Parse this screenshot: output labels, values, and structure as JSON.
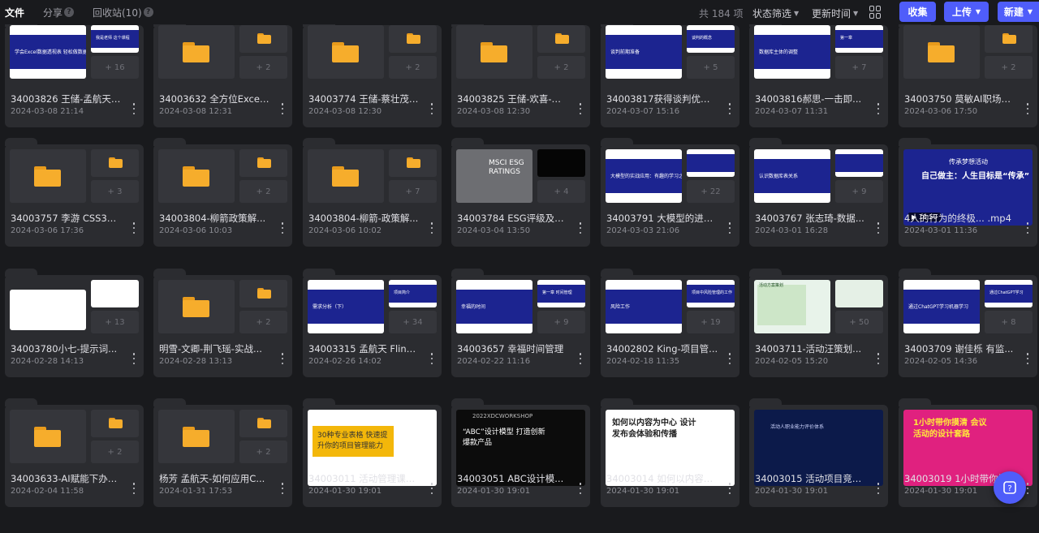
{
  "tabs": [
    {
      "label": "文件",
      "active": true
    },
    {
      "label": "分享",
      "active": false
    },
    {
      "label": "回收站(10)",
      "active": false
    }
  ],
  "toolbar": {
    "count": "共 184 项",
    "status_filter": "状态筛选",
    "update_time": "更新时间",
    "view_icon": "grid-view-icon",
    "collect_label": "收集",
    "upload_label": "上传",
    "new_label": "新建"
  },
  "colors": {
    "accent": "#4f5dfa",
    "folder": "#f6ad2c",
    "slide_navy": "#1c2490"
  },
  "cards": [
    {
      "name": "34003826 王储-孟航天 ...",
      "date": "2024-03-08 21:14",
      "count": "+ 16",
      "kind": "slides-navy",
      "big_text": "学会Excel数据透视表 轻松做数据统计",
      "sm_text": "我是老师 这个课程"
    },
    {
      "name": "34003632 全方位Excel...",
      "date": "2024-03-08 12:31",
      "count": "+ 2",
      "kind": "folder"
    },
    {
      "name": "34003774 王储-蔡壮茂-...",
      "date": "2024-03-08 12:30",
      "count": "+ 2",
      "kind": "folder"
    },
    {
      "name": "34003825 王储-欢喜-内...",
      "date": "2024-03-08 12:30",
      "count": "+ 2",
      "kind": "folder"
    },
    {
      "name": "34003817获得谈判优势...",
      "date": "2024-03-07 15:16",
      "count": "+ 5",
      "kind": "slides-navy",
      "big_text": "谈判前期准备",
      "sm_text": "谈判的概念"
    },
    {
      "name": "34003816郝思-一击即...",
      "date": "2024-03-07 11:31",
      "count": "+ 7",
      "kind": "slides-navy",
      "big_text": "数据库主体的调整",
      "sm_text": "第一章"
    },
    {
      "name": "34003750 莫敏AI职场发...",
      "date": "2024-03-06 17:50",
      "count": "+ 2",
      "kind": "folder"
    },
    {
      "name": "34003757 李游 CSS3课...",
      "date": "2024-03-06 17:36",
      "count": "+ 3",
      "kind": "folder"
    },
    {
      "name": "34003804-柳箭政策解...",
      "date": "2024-03-06 10:03",
      "count": "+ 2",
      "kind": "folder"
    },
    {
      "name": "34003804-柳箭-政策解...",
      "date": "2024-03-06 10:02",
      "count": "+ 7",
      "kind": "folder"
    },
    {
      "name": "34003784 ESG评级及方...",
      "date": "2024-03-04 13:50",
      "count": "+ 4",
      "kind": "esg",
      "big_text": "MSCI ESG RATINGS",
      "sm_text": ""
    },
    {
      "name": "34003791 大模型的进阶...",
      "date": "2024-03-03 21:06",
      "count": "+ 22",
      "kind": "slides-navy",
      "big_text": "大模型的实战应用：有趣的学习之机器学习",
      "sm_text": ""
    },
    {
      "name": "34003767 张志琦-数据...",
      "date": "2024-03-01 16:28",
      "count": "+ 9",
      "kind": "slides-navy",
      "big_text": "认识数据库表关系",
      "sm_text": ""
    },
    {
      "name": "4人的行为的终极...   .mp4",
      "date": "2024-03-01 11:36",
      "count": "",
      "kind": "video",
      "big_text": "传承梦想活动",
      "sm_text": "自己做主：人生目标是“传承”",
      "duration": "10:50"
    },
    {
      "name": "34003780小七-提示词...",
      "date": "2024-02-28 14:13",
      "count": "+ 13",
      "kind": "white",
      "big_text": "",
      "sm_text": ""
    },
    {
      "name": "明雪-文卿-荆飞瑶-实战...",
      "date": "2024-02-28 13:13",
      "count": "+ 2",
      "kind": "folder"
    },
    {
      "name": "34003315 孟航天 Flink...",
      "date": "2024-02-26 14:02",
      "count": "+ 34",
      "kind": "slides-navy",
      "big_text": "需求分析（下）",
      "sm_text": "项目简介"
    },
    {
      "name": "34003657 幸福时间管理",
      "date": "2024-02-22 11:16",
      "count": "+ 9",
      "kind": "slides-navy",
      "big_text": "幸福的时间",
      "sm_text": "第一章 时间管理"
    },
    {
      "name": "34002802 King-项目管...",
      "date": "2024-02-18 11:35",
      "count": "+ 19",
      "kind": "slides-navy",
      "big_text": "风险工作",
      "sm_text": "项目中风险管理的工作"
    },
    {
      "name": "34003711-活动汪策划...",
      "date": "2024-02-05 15:20",
      "count": "+ 50",
      "kind": "green",
      "big_text": "活动方案策划",
      "sm_text": ""
    },
    {
      "name": "34003709 谢佳栎 有监...",
      "date": "2024-02-05 14:36",
      "count": "+ 8",
      "kind": "slides-navy",
      "big_text": "通过ChatGPT学习机器学习",
      "sm_text": "通过ChatGPT学习"
    },
    {
      "name": "34003633-AI赋能下办公...",
      "date": "2024-02-04 11:58",
      "count": "+ 2",
      "kind": "folder"
    },
    {
      "name": "杨芳 孟航天-如何应用C...",
      "date": "2024-01-31 17:53",
      "count": "+ 2",
      "kind": "folder"
    },
    {
      "name": "34003011 活动管理课：...",
      "date": "2024-01-30 19:01",
      "count": "",
      "kind": "yellow-cover",
      "big_text": "30种专业表格 快速提升你的项目管理能力",
      "sm_text": ""
    },
    {
      "name": "34003051 ABC设计模...",
      "date": "2024-01-30 19:01",
      "count": "",
      "kind": "dark-cover",
      "big_text": "“ABC”设计模型 打造创新爆款产品",
      "sm_text": "2022XDCWORKSHOP"
    },
    {
      "name": "34003014 如何以内容为...",
      "date": "2024-01-30 19:01",
      "count": "",
      "kind": "white-cover",
      "big_text": "如何以内容为中心 设计发布会体验和传播",
      "sm_text": ""
    },
    {
      "name": "34003015 活动项目竞标...",
      "date": "2024-01-30 19:01",
      "count": "",
      "kind": "navy-cover",
      "big_text": "活动人职业能力评价体系",
      "sm_text": ""
    },
    {
      "name": "34003019 1小时带你摸...",
      "date": "2024-01-30 19:01",
      "count": "",
      "kind": "pink-cover",
      "big_text": "1小时带你摸清 会议活动的设计套路",
      "sm_text": ""
    }
  ]
}
